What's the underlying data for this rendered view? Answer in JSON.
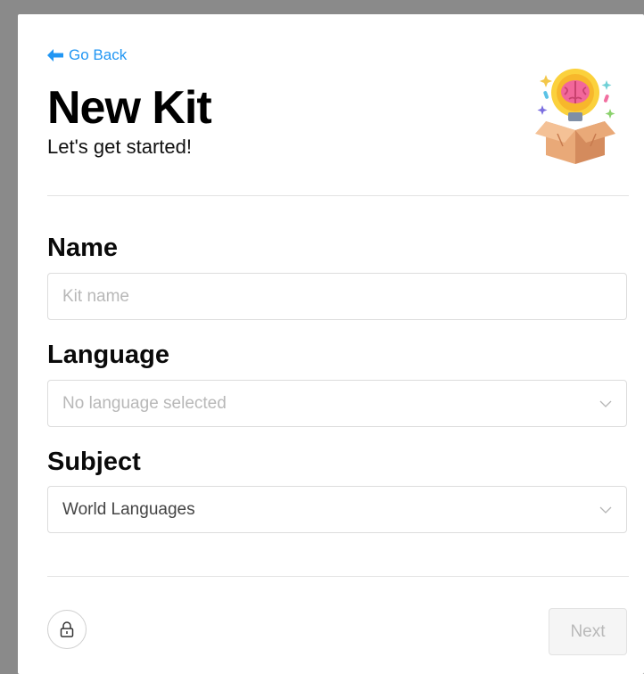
{
  "nav": {
    "back_label": "Go Back"
  },
  "header": {
    "title": "New Kit",
    "subtitle": "Let's get started!",
    "illustration_icon": "lightbulb-brain-box-icon"
  },
  "form": {
    "name": {
      "label": "Name",
      "placeholder": "Kit name",
      "value": ""
    },
    "language": {
      "label": "Language",
      "selected": "No language selected",
      "is_placeholder": true
    },
    "subject": {
      "label": "Subject",
      "selected": "World Languages",
      "is_placeholder": false
    }
  },
  "footer": {
    "lock_icon": "lock-icon",
    "next_label": "Next",
    "next_enabled": false
  },
  "colors": {
    "accent": "#2196f3",
    "background": "#8a8a8a",
    "card": "#ffffff",
    "border": "#dcdcdc",
    "placeholder": "#b8b8b8"
  }
}
